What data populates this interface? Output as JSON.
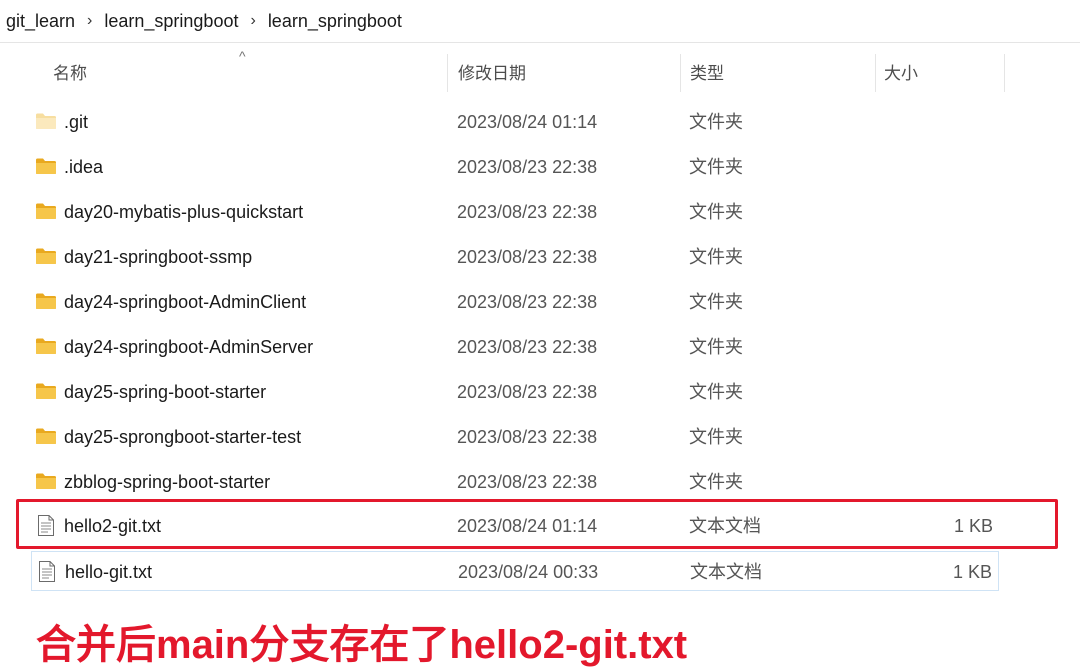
{
  "breadcrumb": [
    "git_learn",
    "learn_springboot",
    "learn_springboot"
  ],
  "columns": {
    "name": "名称",
    "date": "修改日期",
    "type": "类型",
    "size": "大小"
  },
  "files": [
    {
      "name": ".git",
      "date": "2023/08/24 01:14",
      "type": "文件夹",
      "size": "",
      "kind": "folder-faded"
    },
    {
      "name": ".idea",
      "date": "2023/08/23 22:38",
      "type": "文件夹",
      "size": "",
      "kind": "folder"
    },
    {
      "name": "day20-mybatis-plus-quickstart",
      "date": "2023/08/23 22:38",
      "type": "文件夹",
      "size": "",
      "kind": "folder"
    },
    {
      "name": "day21-springboot-ssmp",
      "date": "2023/08/23 22:38",
      "type": "文件夹",
      "size": "",
      "kind": "folder"
    },
    {
      "name": "day24-springboot-AdminClient",
      "date": "2023/08/23 22:38",
      "type": "文件夹",
      "size": "",
      "kind": "folder"
    },
    {
      "name": "day24-springboot-AdminServer",
      "date": "2023/08/23 22:38",
      "type": "文件夹",
      "size": "",
      "kind": "folder"
    },
    {
      "name": "day25-spring-boot-starter",
      "date": "2023/08/23 22:38",
      "type": "文件夹",
      "size": "",
      "kind": "folder"
    },
    {
      "name": "day25-sprongboot-starter-test",
      "date": "2023/08/23 22:38",
      "type": "文件夹",
      "size": "",
      "kind": "folder"
    },
    {
      "name": "zbblog-spring-boot-starter",
      "date": "2023/08/23 22:38",
      "type": "文件夹",
      "size": "",
      "kind": "folder"
    },
    {
      "name": "hello2-git.txt",
      "date": "2023/08/24 01:14",
      "type": "文本文档",
      "size": "1 KB",
      "kind": "text-file"
    },
    {
      "name": "hello-git.txt",
      "date": "2023/08/24 00:33",
      "type": "文本文档",
      "size": "1 KB",
      "kind": "text-file"
    }
  ],
  "caption": "合并后main分支存在了hello2-git.txt",
  "colors": {
    "accent_red": "#e3182c",
    "folder": "#f2c04c",
    "selection_outline": "#cfe3f5"
  },
  "icons": {
    "breadcrumb_separator": "chevron-right-icon",
    "sort": "sort-up-icon",
    "folder": "folder-icon",
    "text_file": "text-file-icon"
  }
}
